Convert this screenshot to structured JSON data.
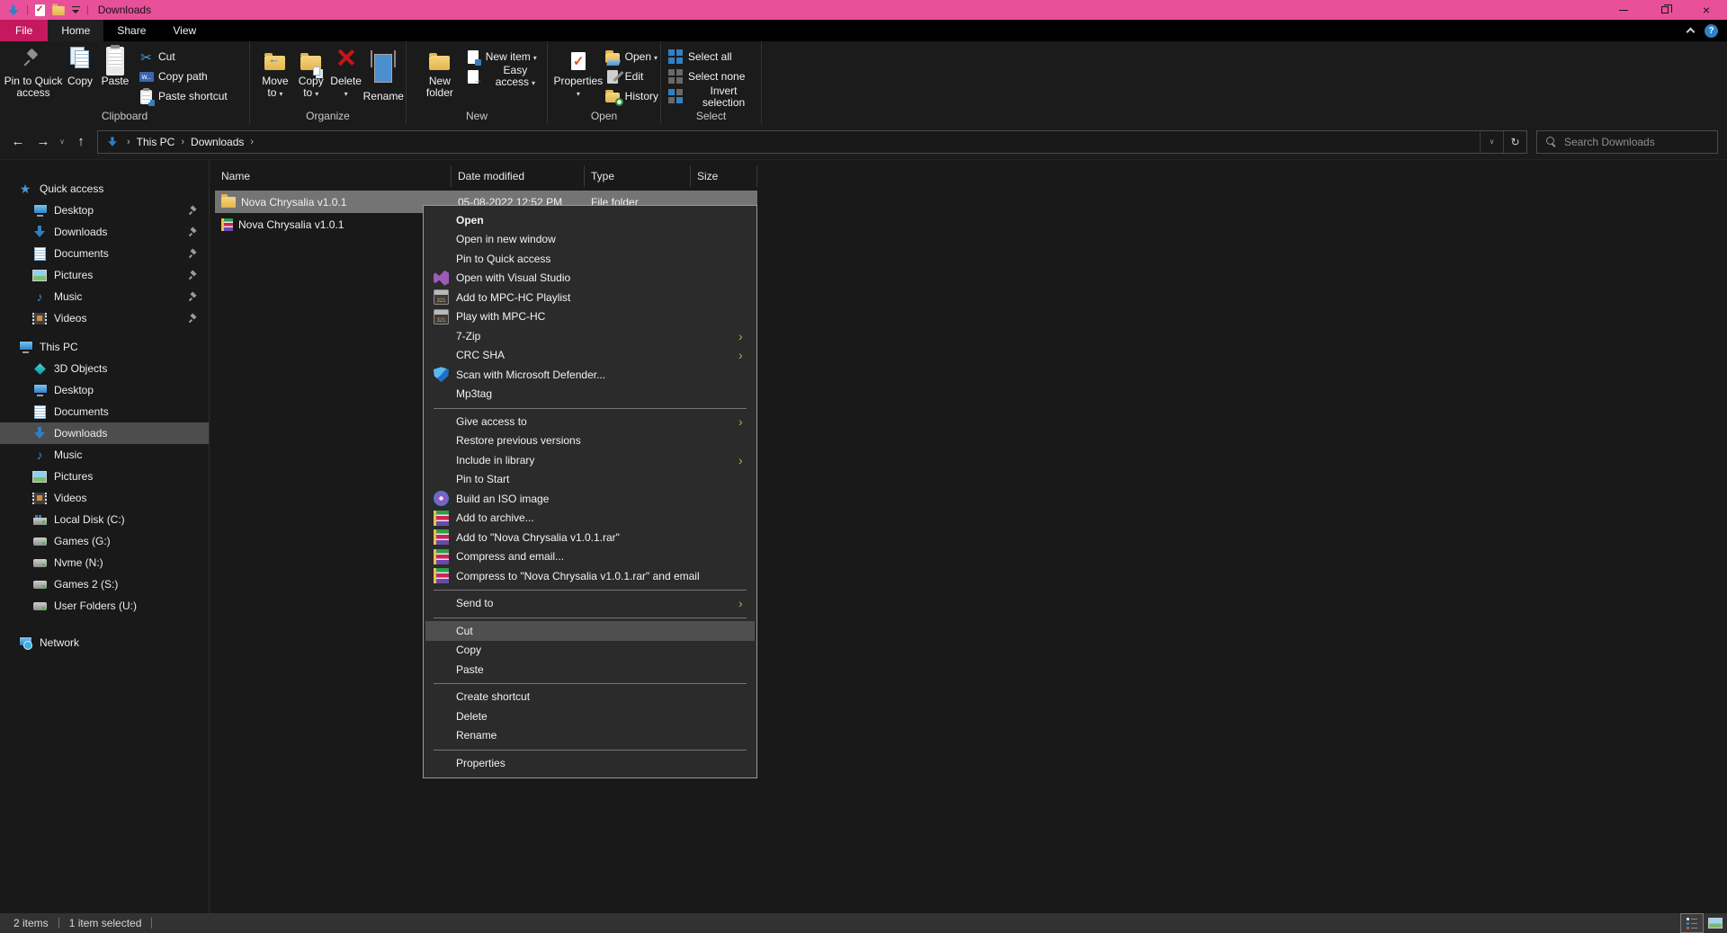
{
  "colors": {
    "accent_titlebar": "#e8509a",
    "file_tab": "#c4195f",
    "row_selection": "#747474",
    "sidebar_selection": "#4d4d4d",
    "menu_highlight": "#4f4f4f",
    "icon_blue": "#2f81c6",
    "folder_yellow": "#e4b54f"
  },
  "titlebar": {
    "title": "Downloads",
    "qat_icons": [
      "downloads",
      "properties-checkbox",
      "new-folder",
      "customize-chevron"
    ],
    "window_buttons": [
      "minimize",
      "restore",
      "close"
    ]
  },
  "tabs": {
    "file": "File",
    "home": "Home",
    "share": "Share",
    "view": "View"
  },
  "ribbon": {
    "clipboard": {
      "label": "Clipboard",
      "pin": "Pin to Quick access",
      "copy": "Copy",
      "paste": "Paste",
      "cut": "Cut",
      "copy_path": "Copy path",
      "paste_shortcut": "Paste shortcut"
    },
    "organize": {
      "label": "Organize",
      "move_to": "Move to",
      "copy_to": "Copy to",
      "delete": "Delete",
      "rename": "Rename"
    },
    "new_group": {
      "label": "New",
      "new_folder": "New folder",
      "new_item": "New item",
      "easy_access": "Easy access"
    },
    "open_group": {
      "label": "Open",
      "properties": "Properties",
      "open": "Open",
      "edit": "Edit",
      "history": "History"
    },
    "select_group": {
      "label": "Select",
      "select_all": "Select all",
      "select_none": "Select none",
      "invert_selection": "Invert selection"
    }
  },
  "address": {
    "crumbs": [
      "This PC",
      "Downloads"
    ],
    "root_icon": "downloads",
    "search_placeholder": "Search Downloads",
    "nav_icons": [
      "back",
      "forward",
      "recent-locations",
      "up",
      "address-dropdown",
      "refresh"
    ]
  },
  "sidebar": {
    "items": [
      {
        "label": "Quick access",
        "icon": "star",
        "cls": "sec"
      },
      {
        "label": "Desktop",
        "icon": "monitor",
        "cls": "child",
        "pinned": true
      },
      {
        "label": "Downloads",
        "icon": "download",
        "cls": "child",
        "pinned": true
      },
      {
        "label": "Documents",
        "icon": "doc",
        "cls": "child",
        "pinned": true
      },
      {
        "label": "Pictures",
        "icon": "pic",
        "cls": "child",
        "pinned": true
      },
      {
        "label": "Music",
        "icon": "music",
        "cls": "child",
        "pinned": true
      },
      {
        "label": "Videos",
        "icon": "film",
        "cls": "child",
        "pinned": true
      },
      {
        "label": "This PC",
        "icon": "monitor",
        "cls": "sec gap8"
      },
      {
        "label": "3D Objects",
        "icon": "cube",
        "cls": "child"
      },
      {
        "label": "Desktop",
        "icon": "monitor",
        "cls": "child"
      },
      {
        "label": "Documents",
        "icon": "doc",
        "cls": "child"
      },
      {
        "label": "Downloads",
        "icon": "download",
        "cls": "child sel"
      },
      {
        "label": "Music",
        "icon": "music",
        "cls": "child"
      },
      {
        "label": "Pictures",
        "icon": "pic",
        "cls": "child"
      },
      {
        "label": "Videos",
        "icon": "film",
        "cls": "child"
      },
      {
        "label": "Local Disk (C:)",
        "icon": "drive-win",
        "cls": "child"
      },
      {
        "label": "Games (G:)",
        "icon": "drive",
        "cls": "child"
      },
      {
        "label": "Nvme (N:)",
        "icon": "drive",
        "cls": "child"
      },
      {
        "label": "Games 2 (S:)",
        "icon": "drive",
        "cls": "child"
      },
      {
        "label": "User Folders (U:)",
        "icon": "drive",
        "cls": "child"
      },
      {
        "label": "Network",
        "icon": "network",
        "cls": "sec gap16"
      }
    ]
  },
  "files": {
    "columns": [
      "Name",
      "Date modified",
      "Type",
      "Size"
    ],
    "rows": [
      {
        "icon": "folder",
        "name": "Nova Chrysalia v1.0.1",
        "modified": "05-08-2022 12:52 PM",
        "type": "File folder",
        "size": "",
        "cls": "sel"
      },
      {
        "icon": "winrar",
        "name": "Nova Chrysalia v1.0.1",
        "modified": "",
        "type": "",
        "size": "",
        "cls": ""
      }
    ]
  },
  "context_menu": {
    "items": [
      {
        "label": "Open",
        "cls": "bold"
      },
      {
        "label": "Open in new window"
      },
      {
        "label": "Pin to Quick access"
      },
      {
        "label": "Open with Visual Studio",
        "icon": "vs"
      },
      {
        "label": "Add to MPC-HC Playlist",
        "icon": "mpc"
      },
      {
        "label": "Play with MPC-HC",
        "icon": "mpc"
      },
      {
        "label": "7-Zip",
        "cls": "sub"
      },
      {
        "label": "CRC SHA",
        "cls": "sub"
      },
      {
        "label": "Scan with Microsoft Defender...",
        "icon": "defender"
      },
      {
        "label": "Mp3tag"
      },
      {
        "cls": "sep"
      },
      {
        "label": "Give access to",
        "cls": "sub"
      },
      {
        "label": "Restore previous versions"
      },
      {
        "label": "Include in library",
        "cls": "sub"
      },
      {
        "label": "Pin to Start"
      },
      {
        "label": "Build an ISO image",
        "icon": "disc"
      },
      {
        "label": "Add to archive...",
        "icon": "winrar"
      },
      {
        "label": "Add to \"Nova Chrysalia v1.0.1.rar\"",
        "icon": "winrar"
      },
      {
        "label": "Compress and email...",
        "icon": "winrar"
      },
      {
        "label": "Compress to \"Nova Chrysalia v1.0.1.rar\" and email",
        "icon": "winrar"
      },
      {
        "cls": "sep"
      },
      {
        "label": "Send to",
        "cls": "sub"
      },
      {
        "cls": "sep"
      },
      {
        "label": "Cut",
        "cls": "hl"
      },
      {
        "label": "Copy"
      },
      {
        "label": "Paste"
      },
      {
        "cls": "sep"
      },
      {
        "label": "Create shortcut"
      },
      {
        "label": "Delete"
      },
      {
        "label": "Rename"
      },
      {
        "cls": "sep"
      },
      {
        "label": "Properties"
      }
    ]
  },
  "statusbar": {
    "count": "2 items",
    "selected": "1 item selected",
    "view_icons": [
      "details-view",
      "thumbnail-view"
    ]
  }
}
